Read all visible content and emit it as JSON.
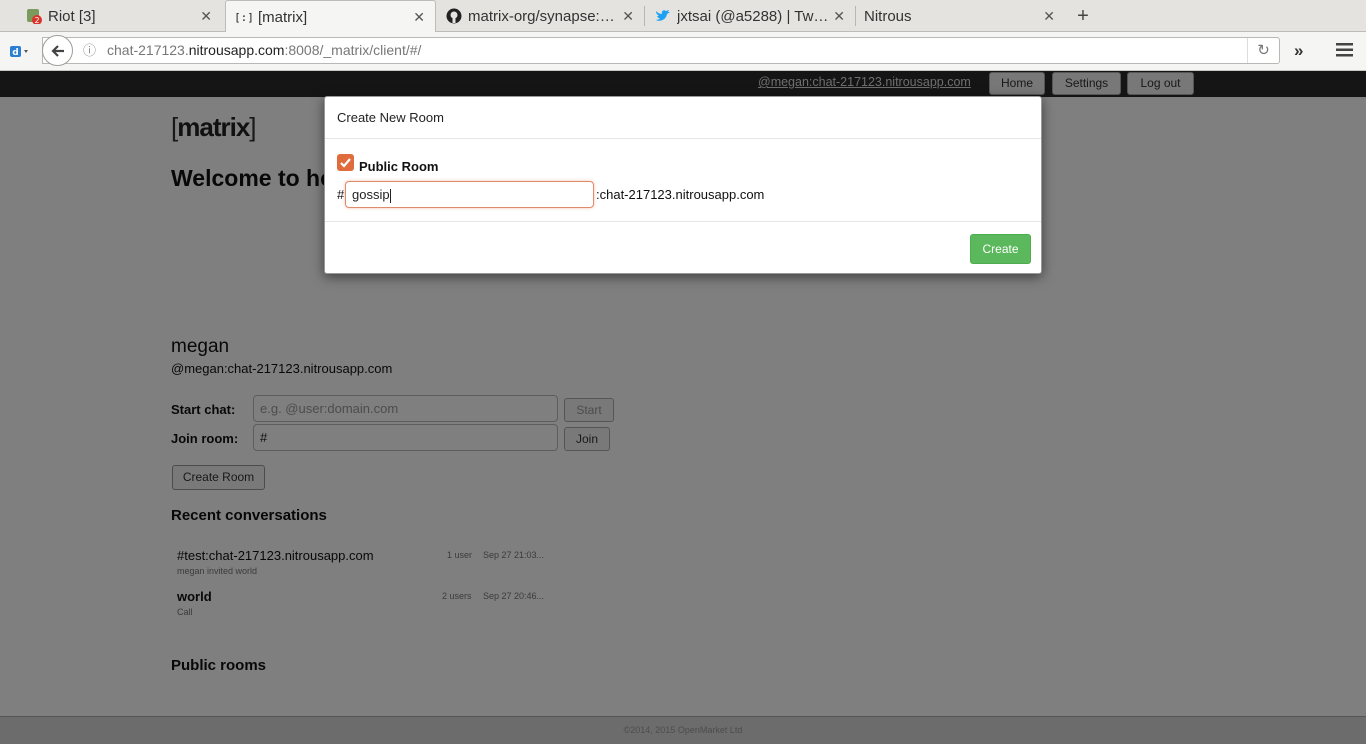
{
  "browser": {
    "tabs": [
      {
        "label": "Riot [3]",
        "icon": "riot-icon"
      },
      {
        "label": "[matrix]",
        "icon": "matrix-icon"
      },
      {
        "label": "matrix-org/synapse:…",
        "icon": "github-icon"
      },
      {
        "label": "jxtsai (@a5288) | Tw…",
        "icon": "twitter-icon"
      },
      {
        "label": "Nitrous",
        "icon": ""
      }
    ],
    "riot_badge": "2",
    "url_prefix": "chat-217123.",
    "url_host": "nitrousapp.com",
    "url_suffix": ":8008/_matrix/client/#/"
  },
  "topbar": {
    "user_link": "@megan:chat-217123.nitrousapp.com",
    "home": "Home",
    "settings": "Settings",
    "logout": "Log out"
  },
  "main": {
    "logo": "matrix",
    "welcome": "Welcome to ho",
    "display_name": "megan",
    "user_id": "@megan:chat-217123.nitrousapp.com",
    "start_chat_label": "Start chat:",
    "start_chat_placeholder": "e.g. @user:domain.com",
    "start_button": "Start",
    "join_room_label": "Join room:",
    "join_room_value": "#",
    "join_button": "Join",
    "create_room_button": "Create Room",
    "recent_heading": "Recent conversations",
    "conversations": [
      {
        "name": "#test:chat-217123.nitrousapp.com",
        "users": "1 user",
        "date": "Sep 27 21:03...",
        "last_message": "megan invited world"
      },
      {
        "name": "world",
        "users": "2 users",
        "date": "Sep 27 20:46...",
        "last_message": "Call"
      }
    ],
    "public_heading": "Public rooms",
    "footer": "©2014, 2015 OpenMarket Ltd"
  },
  "modal": {
    "title": "Create New Room",
    "public_label": "Public Room",
    "public_checked": true,
    "hash": "#",
    "alias_value": "gossip",
    "domain_suffix": ":chat-217123.nitrousapp.com",
    "create_button": "Create"
  },
  "colors": {
    "accent": "#e06b3c",
    "create_button": "#5cb85c"
  }
}
